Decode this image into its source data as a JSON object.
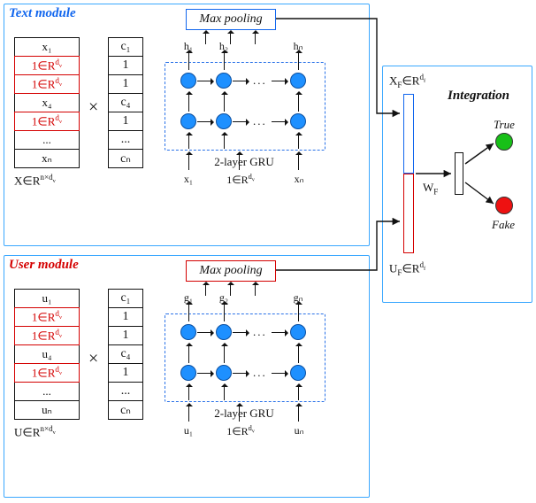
{
  "modules": {
    "text": {
      "title": "Text module",
      "vec_cells": [
        "x₁",
        "1∈R^{d_v}",
        "1∈R^{d_v}",
        "x₄",
        "1∈R^{d_v}",
        "...",
        "xₙ"
      ],
      "vec_caption": "X∈R^{n×d_v}",
      "coef_cells": [
        "c₁",
        "1",
        "1",
        "c₄",
        "1",
        "...",
        "cₙ"
      ],
      "op": "×",
      "max_pool": "Max pooling",
      "gru_label": "2-layer GRU",
      "gru_top_labels": [
        "h₁",
        "h₂",
        "hₙ"
      ],
      "gru_in_labels": [
        "x₁",
        "1∈R^{d_v}",
        "xₙ"
      ]
    },
    "user": {
      "title": "User module",
      "vec_cells": [
        "u₁",
        "1∈R^{d_v}",
        "1∈R^{d_v}",
        "u₄",
        "1∈R^{d_v}",
        "...",
        "uₙ"
      ],
      "vec_caption": "U∈R^{n×d_v}",
      "coef_cells": [
        "c₁",
        "1",
        "1",
        "c₄",
        "1",
        "...",
        "cₙ"
      ],
      "op": "×",
      "max_pool": "Max pooling",
      "gru_label": "2-layer GRU",
      "gru_top_labels": [
        "g₁",
        "g₂",
        "gₙ"
      ],
      "gru_in_labels": [
        "u₁",
        "1∈R^{d_v}",
        "uₙ"
      ]
    }
  },
  "integration": {
    "title": "Integration",
    "xf_label": "X_F∈R^{d_f}",
    "uf_label": "U_F∈R^{d_f}",
    "w_label": "W_F",
    "out_true": "True",
    "out_fake": "Fake"
  },
  "chart_data": {
    "type": "table",
    "description": "Architecture diagram of a two-branch (Text, User) GRU encoder with max-pooling, concatenated and classified True/Fake.",
    "components": [
      {
        "name": "Text module",
        "input": "X ∈ R^{n×d_v}",
        "mask_vector": [
          "c1",
          "1",
          "1",
          "c4",
          "1",
          "...",
          "cn"
        ],
        "encoder": "2-layer GRU",
        "pool": "Max pooling",
        "output": "X_F ∈ R^{d_f}"
      },
      {
        "name": "User module",
        "input": "U ∈ R^{n×d_v}",
        "mask_vector": [
          "c1",
          "1",
          "1",
          "c4",
          "1",
          "...",
          "cn"
        ],
        "encoder": "2-layer GRU",
        "pool": "Max pooling",
        "output": "U_F ∈ R^{d_f}"
      },
      {
        "name": "Integration",
        "inputs": [
          "X_F",
          "U_F"
        ],
        "weight": "W_F",
        "classes": [
          "True",
          "Fake"
        ]
      }
    ]
  }
}
